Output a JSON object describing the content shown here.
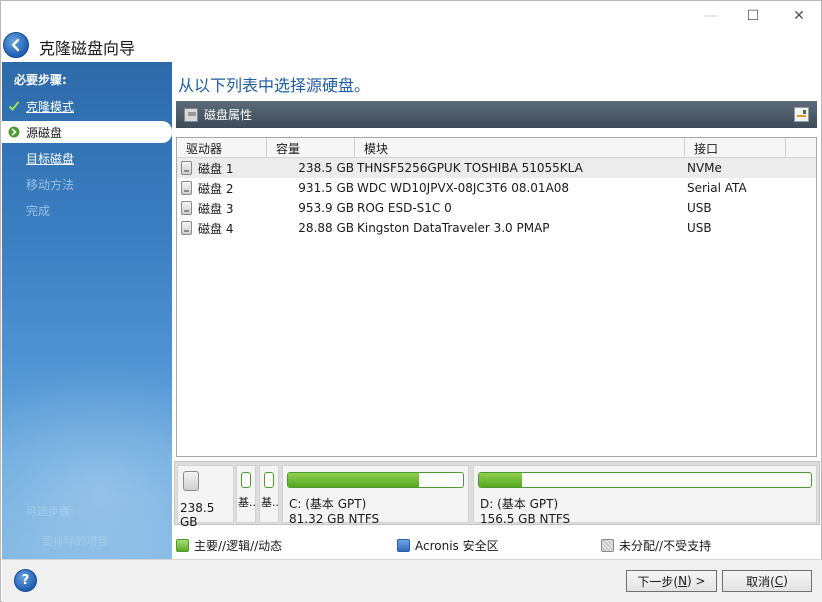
{
  "window": {
    "minimize": "—",
    "maximize": "☐",
    "close": "✕"
  },
  "header": {
    "title": "克隆磁盘向导"
  },
  "sidebar": {
    "heading": "必要步骤:",
    "steps": [
      {
        "label": "克隆模式",
        "state": "done"
      },
      {
        "label": "源磁盘",
        "state": "active"
      },
      {
        "label": "目标磁盘",
        "state": "todo"
      },
      {
        "label": "移动方法",
        "state": "disabled"
      },
      {
        "label": "完成",
        "state": "disabled"
      }
    ],
    "faded": [
      "可选步骤:",
      "要排除的项目"
    ]
  },
  "main": {
    "instruction": "从以下列表中选择源硬盘。",
    "props_label": "磁盘属性",
    "columns": [
      "驱动器",
      "容量",
      "模块",
      "接口"
    ],
    "rows": [
      {
        "drive": "磁盘 1",
        "capacity": "238.5 GB",
        "model": "THNSF5256GPUK TOSHIBA 51055KLA",
        "iface": "NVMe",
        "selected": true
      },
      {
        "drive": "磁盘 2",
        "capacity": "931.5 GB",
        "model": "WDC WD10JPVX-08JC3T6 08.01A08",
        "iface": "Serial ATA"
      },
      {
        "drive": "磁盘 3",
        "capacity": "953.9 GB",
        "model": "ROG ESD-S1C 0",
        "iface": "USB"
      },
      {
        "drive": "磁盘 4",
        "capacity": "28.88 GB",
        "model": "Kingston DataTraveler 3.0 PMAP",
        "iface": "USB"
      }
    ]
  },
  "disk_map": {
    "capacity": "238.5 GB",
    "small_parts": [
      "基...",
      "基..."
    ],
    "partitions": [
      {
        "name": "C: (基本 GPT)",
        "info": "81.32 GB  NTFS",
        "used_fraction": 0.75
      },
      {
        "name": "D: (基本 GPT)",
        "info": "156.5 GB  NTFS",
        "used_fraction": 0.13
      }
    ]
  },
  "legend": {
    "primary": "主要//逻辑//动态",
    "acronis": "Acronis 安全区",
    "unallocated": "未分配//不受支持"
  },
  "buttons": {
    "help": "?",
    "next_pre": "下一步(",
    "next_key": "N",
    "next_post": ") >",
    "cancel_pre": "取消(",
    "cancel_key": "C",
    "cancel_post": ")"
  },
  "colors": {
    "accent": "#1f5da8",
    "sidebar": "#3b7fc2",
    "partition_fill": "#56a621"
  }
}
